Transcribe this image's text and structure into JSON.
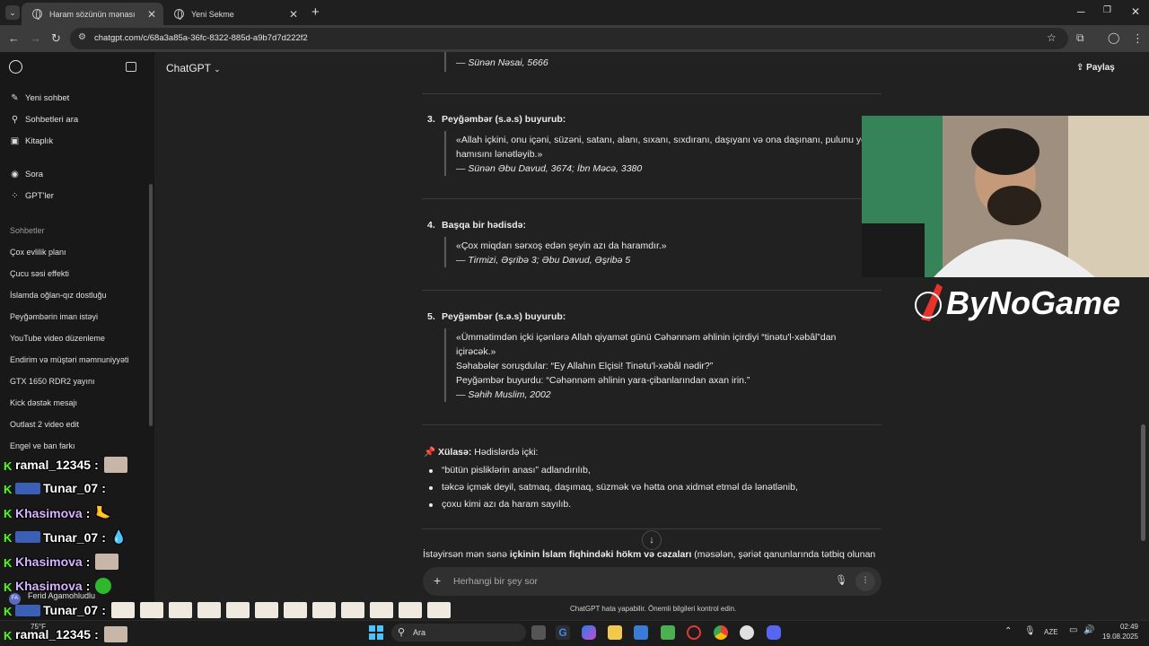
{
  "browser": {
    "tabs": [
      {
        "title": "Haram sözünün mənası",
        "active": true
      },
      {
        "title": "Yeni Sekme",
        "active": false
      }
    ],
    "url": "chatgpt.com/c/68a3a85a-36fc-8322-885d-a9b7d7d222f2"
  },
  "sidebar": {
    "top_items": [
      "Yeni sohbet",
      "Sohbetleri ara",
      "Kitaplık"
    ],
    "mid_items": [
      "Sora",
      "GPT'ler"
    ],
    "section_title": "Sohbetler",
    "chats": [
      "Çox evlilik planı",
      "Çucu səsi effekti",
      "İslamda oğlan-qız dostluğu",
      "Peyğəmbərin iman istəyi",
      "YouTube video düzenleme",
      "Endirim və müştəri məmnuniyyəti",
      "GTX 1650 RDR2 yayını",
      "Kick dəstək mesajı",
      "Outlast 2 video edit",
      "Engel ve ban farkı"
    ],
    "user_name": "Ferid Agamohludlu",
    "user_initials": "FA"
  },
  "header": {
    "model": "ChatGPT",
    "share": "Paylaş"
  },
  "content": {
    "top_source": "— Sünən Nəsai, 5666",
    "items": [
      {
        "number": "3.",
        "heading": "Peyğəmbər (s.ə.s) buyurub:",
        "lines": [
          "«Allah içkini, onu içəni, süzəni, satanı, alanı, sıxanı, sıxdıranı, daşıyanı və ona daşınanı, pulunu yeyəni –",
          "hamısını lənətləyib.»"
        ],
        "source": "— Sünən Əbu Davud, 3674; İbn Məcə, 3380"
      },
      {
        "number": "4.",
        "heading": "Başqa bir hədisdə:",
        "lines": [
          "«Çox miqdarı sərxoş edən şeyin azı da haramdır.»"
        ],
        "source": "— Tirmizi, Əşribə 3; Əbu Davud, Əşribə 5"
      },
      {
        "number": "5.",
        "heading": "Peyğəmbər (s.ə.s) buyurub:",
        "lines": [
          "«Ümmətimdən içki içənlərə Allah qiyamət günü Cəhənnəm əhlinin içirdiyi “tinətu'l-xəbâl”dan",
          "içirəcək.»",
          "Səhabələr soruşdular: “Ey Allahın Elçisi! Tinətu'l-xəbâl nədir?”",
          "Peyğəmbər buyurdu: “Cəhənnəm əhlinin yara-çibanlarından axan irin.”"
        ],
        "source": "— Səhih Muslim, 2002"
      }
    ],
    "summary_label": "Xülasə:",
    "summary_intro": "Hədislərdə içki:",
    "bullets": [
      "“bütün pisliklərin anası” adlandırılıb,",
      "təkcə içmək deyil, satmaq, daşımaq, süzmək və hətta ona xidmət etməl də lənətlənib,",
      "çoxu kimi azı da haram sayılıb."
    ],
    "followup_pre": "İstəyirsən mən sənə ",
    "followup_bold": "içkinin İslam fiqhindəki hökm və cəzaları",
    "followup_post": " (məsələn, şəriət qanunlarında tətbiq olunan"
  },
  "composer": {
    "placeholder": "Herhangi bir şey sor",
    "disclaimer": "ChatGPT hata yapabilir. Önemli bilgileri kontrol edin."
  },
  "overlay": {
    "brand": "ByNoGame",
    "chat": [
      {
        "user": "ramal_12345",
        "color": "#ffffff"
      },
      {
        "user": "Tunar_07",
        "color": "#ffffff"
      },
      {
        "user": "Khasimova",
        "color": "#d9b3ff"
      },
      {
        "user": "Tunar_07",
        "color": "#ffffff"
      },
      {
        "user": "Khasimova",
        "color": "#d9b3ff"
      },
      {
        "user": "Khasimova",
        "color": "#d9b3ff"
      },
      {
        "user": "Tunar_07",
        "color": "#ffffff"
      },
      {
        "user": "ramal_12345",
        "color": "#ffffff"
      }
    ]
  },
  "taskbar": {
    "search": "Ara",
    "temp": "75°F",
    "lang": "AZE",
    "time": "02:49",
    "date": "19.08.2025"
  }
}
